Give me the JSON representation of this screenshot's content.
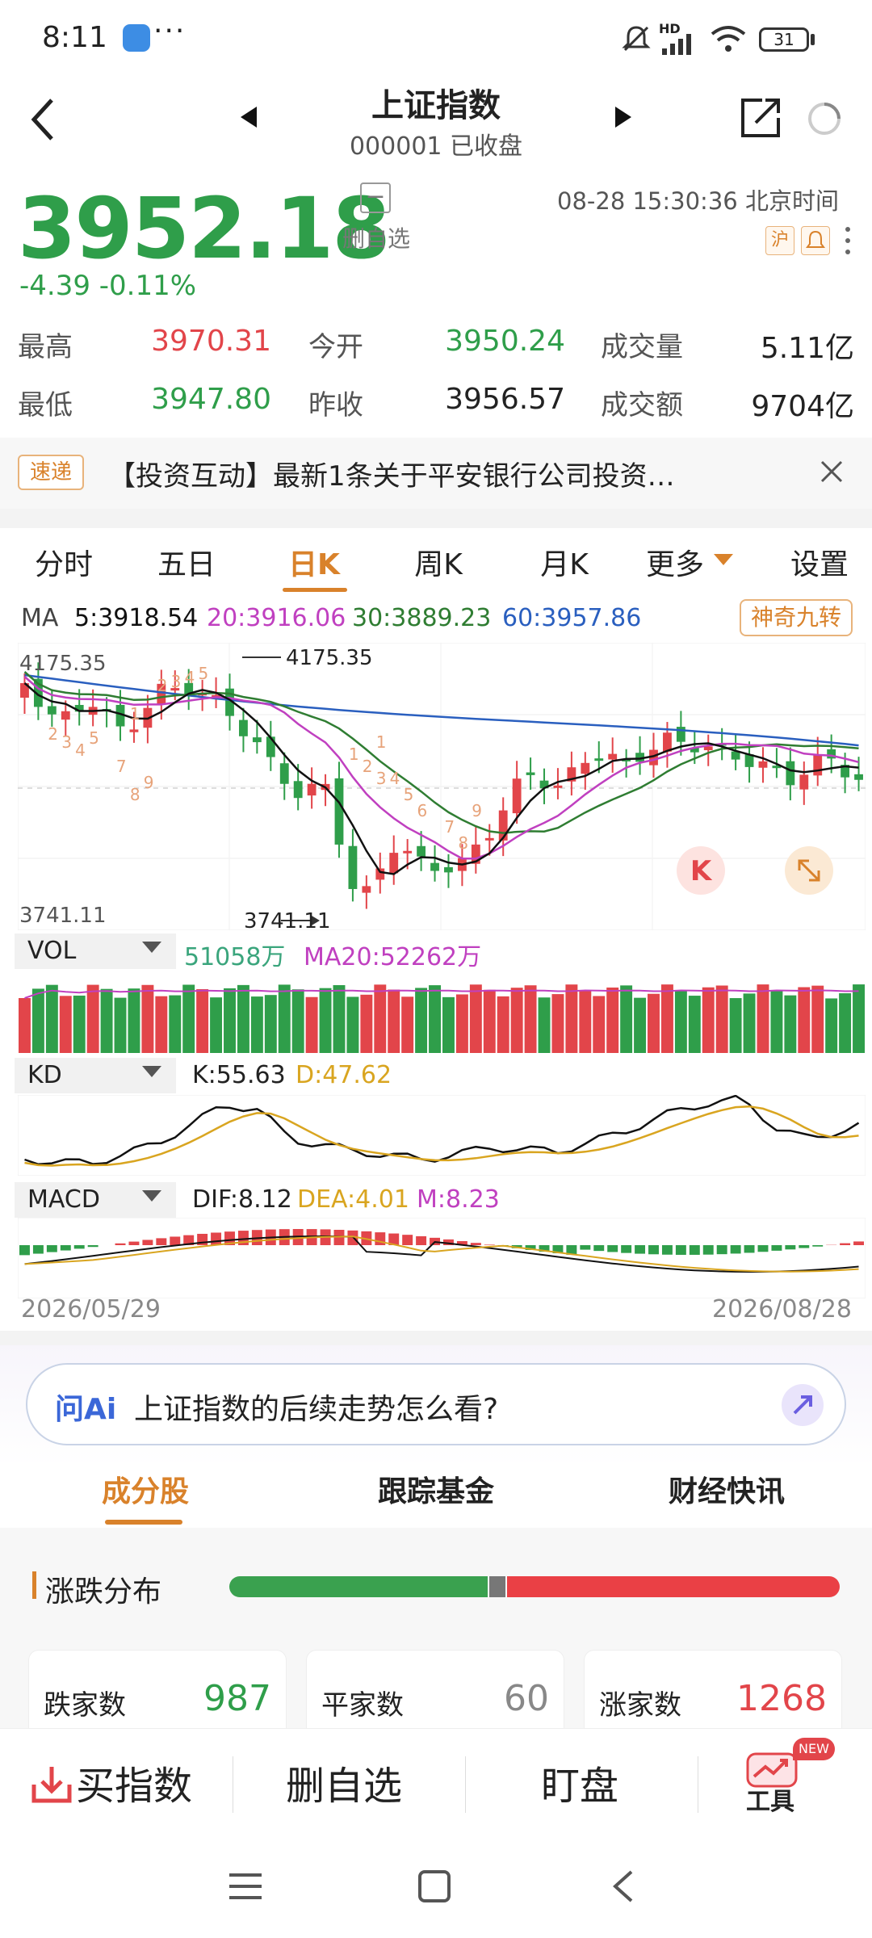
{
  "status": {
    "time": "8:11",
    "battery": "31",
    "dots": "···",
    "hd": "HD"
  },
  "header": {
    "title": "上证指数",
    "subtitle": "000001 已收盘"
  },
  "price": {
    "value": "3952.18",
    "change": "-4.39 -0.11%",
    "fav_label": "删自选",
    "datetime": "08-28 15:30:36 北京时间",
    "tag_hu": "沪"
  },
  "stats": {
    "high_label": "最高",
    "high": "3970.31",
    "open_label": "今开",
    "open": "3950.24",
    "volume_label": "成交量",
    "volume": "5.11亿",
    "low_label": "最低",
    "low": "3947.80",
    "prev_label": "昨收",
    "prev": "3956.57",
    "amount_label": "成交额",
    "amount": "9704亿"
  },
  "notice": {
    "badge": "速递",
    "text": "【投资互动】最新1条关于平安银行公司投资…"
  },
  "tabs": [
    "分时",
    "五日",
    "日K",
    "周K",
    "月K",
    "更多",
    "设置"
  ],
  "ma": {
    "label": "MA",
    "ma5": "5:3918.54",
    "ma20": "20:3916.06",
    "ma30": "30:3889.23",
    "ma60": "60:3957.86",
    "magic": "神奇九转"
  },
  "kline": {
    "top_price": "4175.35",
    "top_marker": "4175.35",
    "bottom_price": "3741.11",
    "bottom_marker": "3741.11",
    "k_badge": "K"
  },
  "vol": {
    "label": "VOL",
    "value": "51058万",
    "ma20": "MA20:52262万"
  },
  "kd": {
    "label": "KD",
    "k": "K:55.63",
    "d": "D:47.62"
  },
  "macd": {
    "label": "MACD",
    "dif": "DIF:8.12",
    "dea": "DEA:4.01",
    "m": "M:8.23",
    "start_date": "2026/05/29",
    "end_date": "2026/08/28"
  },
  "ai": {
    "logo": "问Ai",
    "prompt": "上证指数的后续走势怎么看?"
  },
  "bottom_tabs": [
    "成分股",
    "跟踪基金",
    "财经快讯"
  ],
  "distribution": {
    "title": "涨跌分布",
    "down_label": "跌家数",
    "down": "987",
    "flat_label": "平家数",
    "flat": "60",
    "up_label": "涨家数",
    "up": "1268"
  },
  "actions": {
    "buy": "买指数",
    "unfav": "删自选",
    "watch": "盯盘",
    "tools": "工具",
    "new_badge": "NEW"
  },
  "colors": {
    "up": "#e2454a",
    "down": "#2f9e4a",
    "accent": "#d9822b",
    "ma5": "#111111",
    "ma20": "#c040c0",
    "ma30": "#2f7d32",
    "ma60": "#2a5fbf"
  }
}
